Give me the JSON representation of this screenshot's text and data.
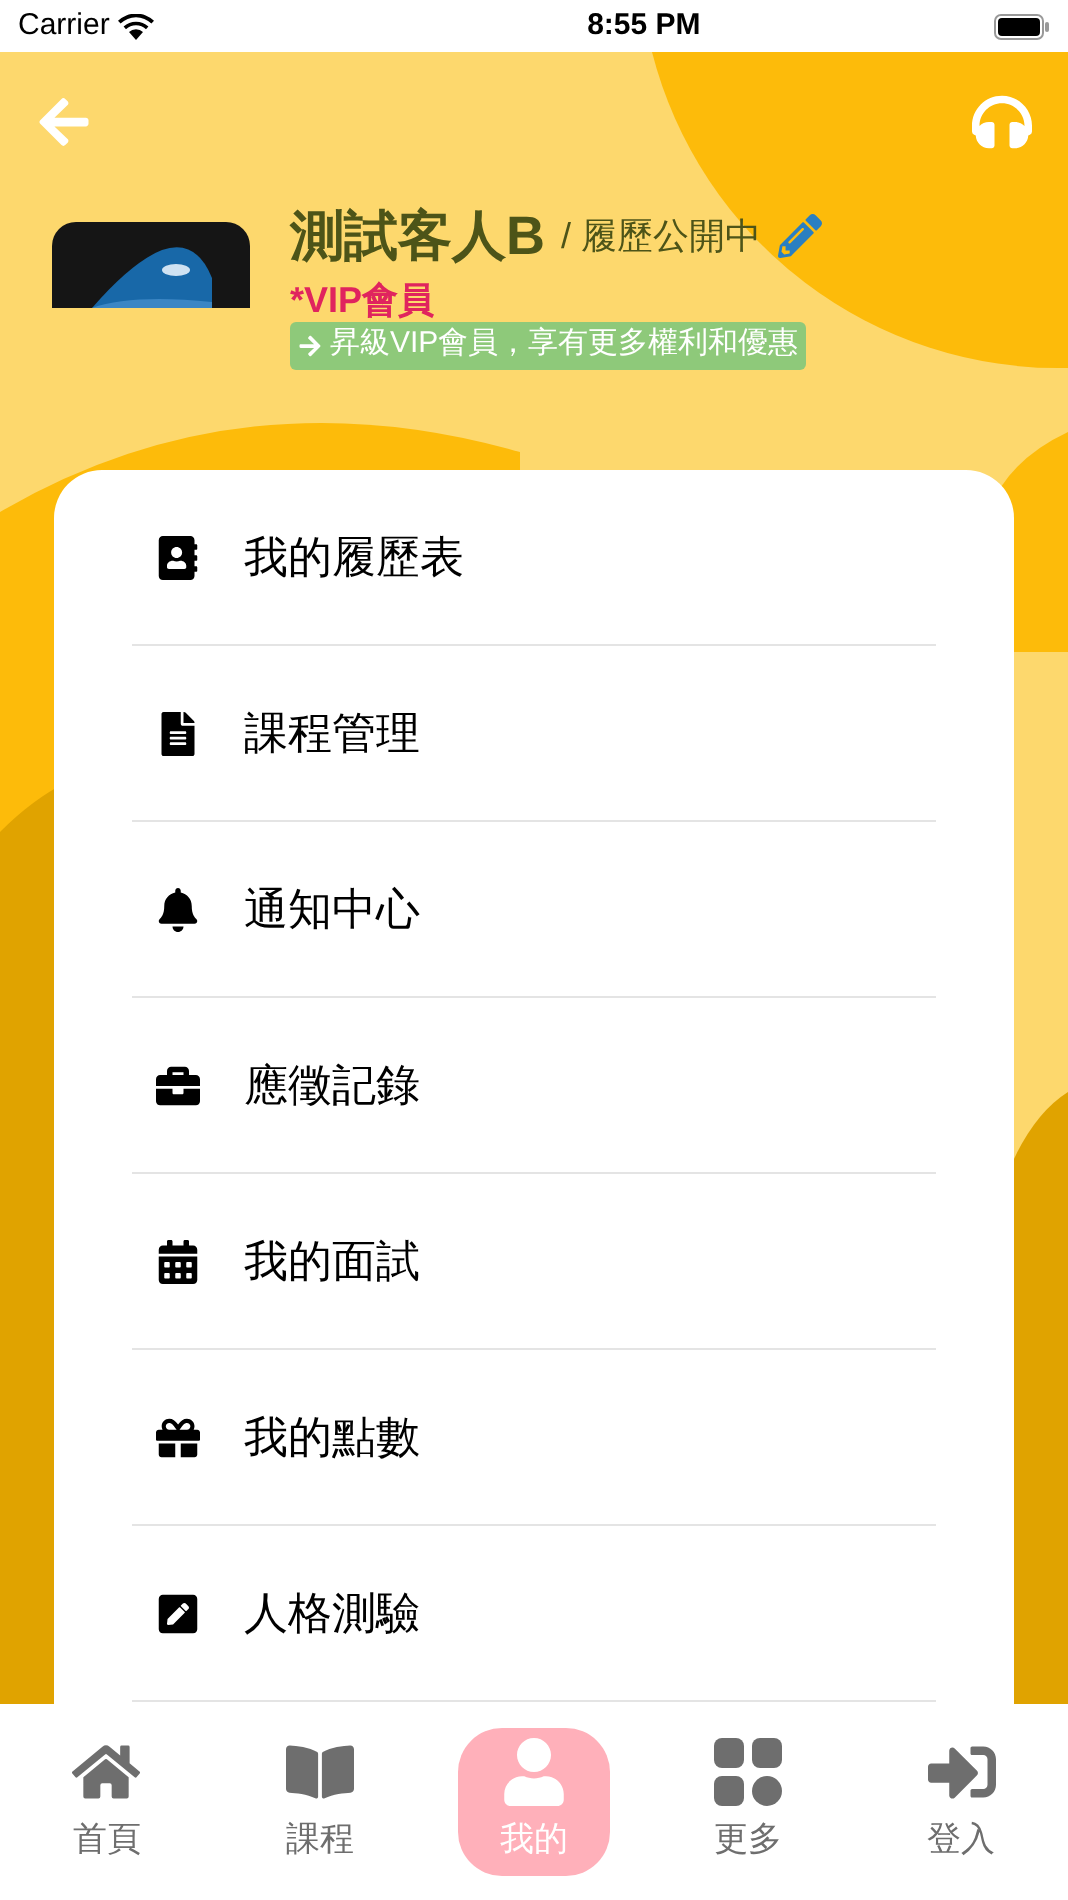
{
  "status_bar": {
    "carrier": "Carrier",
    "time": "8:55 PM"
  },
  "profile": {
    "name": "測試客人B",
    "resume_status": "/ 履歷公開中",
    "membership": "*VIP會員",
    "upgrade_banner": "昇級VIP會員，享有更多權利和優惠"
  },
  "menu": [
    {
      "kind": "resume",
      "label": "我的履歷表"
    },
    {
      "kind": "document",
      "label": "課程管理"
    },
    {
      "kind": "bell",
      "label": "通知中心"
    },
    {
      "kind": "briefcase",
      "label": "應徵記錄"
    },
    {
      "kind": "calendar",
      "label": "我的面試"
    },
    {
      "kind": "gift",
      "label": "我的點數"
    },
    {
      "kind": "edit",
      "label": "人格測驗"
    }
  ],
  "tab_bar": [
    {
      "kind": "home",
      "label": "首頁",
      "selected": false
    },
    {
      "kind": "book",
      "label": "課程",
      "selected": false
    },
    {
      "kind": "user",
      "label": "我的",
      "selected": true
    },
    {
      "kind": "grid",
      "label": "更多",
      "selected": false
    },
    {
      "kind": "login",
      "label": "登入",
      "selected": false
    }
  ]
}
